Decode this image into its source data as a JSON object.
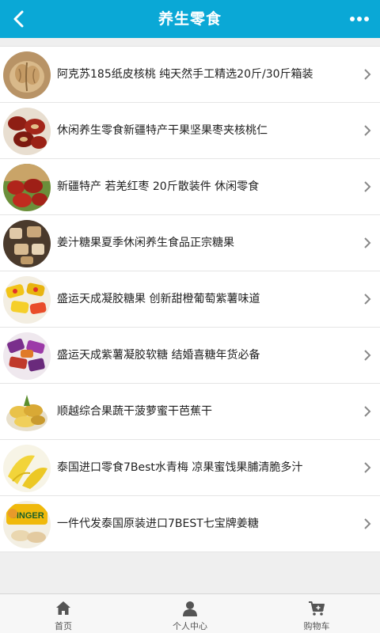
{
  "header": {
    "title": "养生零食",
    "back_icon": "back-arrow-icon",
    "more_icon": "more-dots-icon"
  },
  "colors": {
    "header_bg": "#0aa8d6",
    "page_bg": "#efefef"
  },
  "products": [
    {
      "name": "阿克苏185纸皮核桃 纯天然手工精选20斤/30斤箱装",
      "image": "walnuts"
    },
    {
      "name": "休闲养生零食新疆特产干果坚果枣夹核桃仁",
      "image": "dates-with-walnut"
    },
    {
      "name": "新疆特产 若羌红枣 20斤散装件 休闲零食",
      "image": "red-dates"
    },
    {
      "name": "姜汁糖果夏季休闲养生食品正宗糖果",
      "image": "ginger-candy"
    },
    {
      "name": "盛运天成凝胶糖果 创新甜橙葡萄紫薯味道",
      "image": "jelly-candy"
    },
    {
      "name": "盛运天成紫薯凝胶软糖 结婚喜糖年货必备",
      "image": "purple-candy"
    },
    {
      "name": "顺越综合果蔬干菠萝蜜干芭蕉干",
      "image": "dried-fruit"
    },
    {
      "name": "泰国进口零食7Best水青梅 凉果蜜饯果脯清脆多汁",
      "image": "green-plum"
    },
    {
      "name": "一件代发泰国原装进口7BEST七宝牌姜糖",
      "image": "ginger-pack"
    }
  ],
  "badge_text": {
    "ginger_pack": "GINGER"
  },
  "footer": {
    "tabs": [
      {
        "label": "首页",
        "icon": "home-icon"
      },
      {
        "label": "个人中心",
        "icon": "user-icon"
      },
      {
        "label": "购物车",
        "icon": "cart-icon"
      }
    ]
  }
}
